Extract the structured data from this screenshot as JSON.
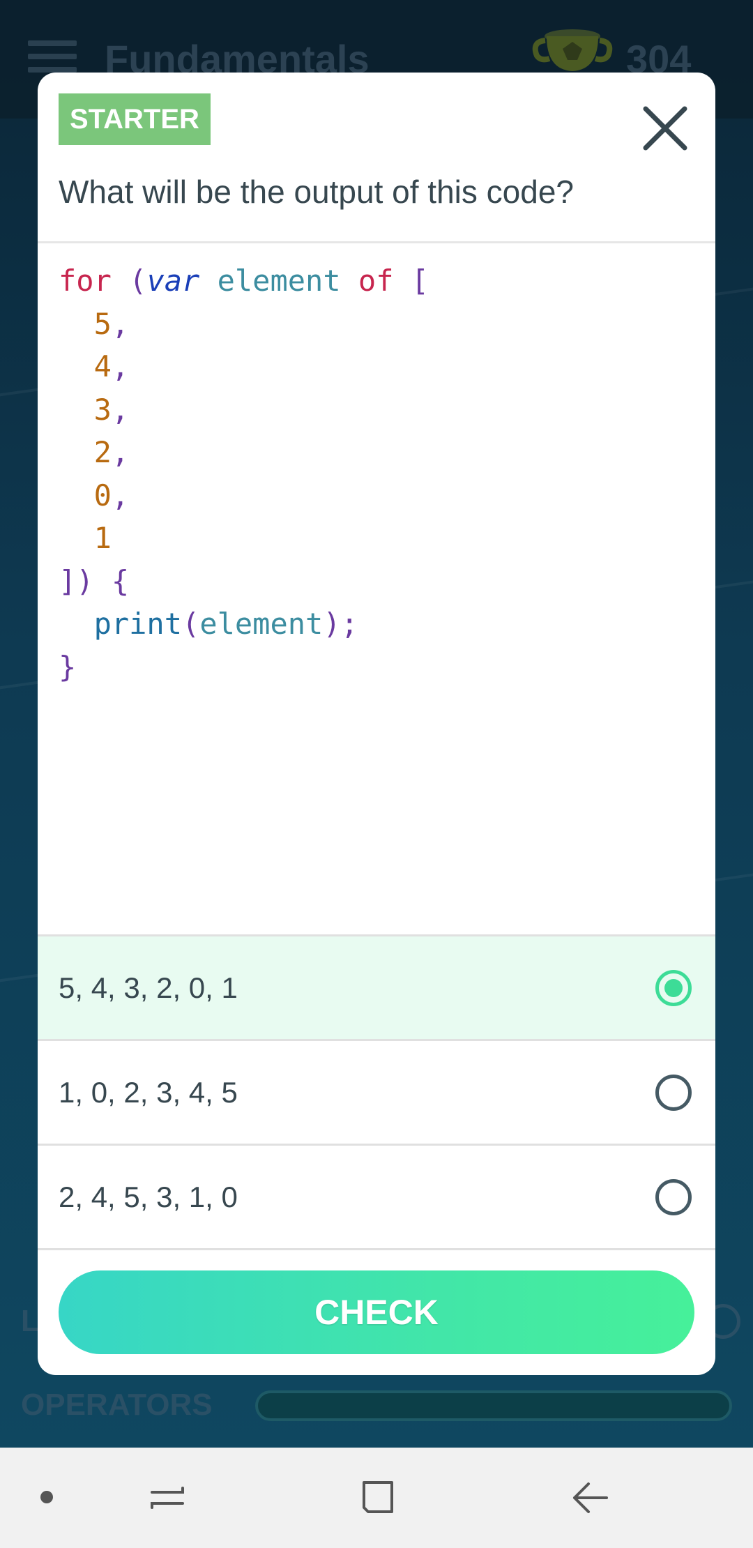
{
  "background": {
    "header_title": "Fundamentals",
    "score": "304",
    "partial_label": "L",
    "section_label": "OPERATORS"
  },
  "modal": {
    "badge": "STARTER",
    "question": "What will be the output of this code?",
    "code_lines": [
      "for (var element of [",
      "  5,",
      "  4,",
      "  3,",
      "  2,",
      "  0,",
      "  1",
      "]) {",
      "  print(element);",
      "}"
    ],
    "options": [
      {
        "label": "5, 4, 3, 2, 0, 1",
        "selected": true
      },
      {
        "label": "1, 0, 2, 3, 4, 5",
        "selected": false
      },
      {
        "label": "2, 4, 5, 3, 1, 0",
        "selected": false
      }
    ],
    "check_label": "CHECK"
  },
  "colors": {
    "badge": "#7bc67b",
    "selected_bg": "#e8fbf1",
    "radio_selected": "#3ddc97",
    "check_start": "#37d6c6",
    "check_end": "#46f09a"
  },
  "icons": {
    "close": "close-icon",
    "menu": "hamburger-icon",
    "trophy": "trophy-icon",
    "nav_recent": "recent-apps-icon",
    "nav_home": "home-icon",
    "nav_back": "back-icon"
  }
}
